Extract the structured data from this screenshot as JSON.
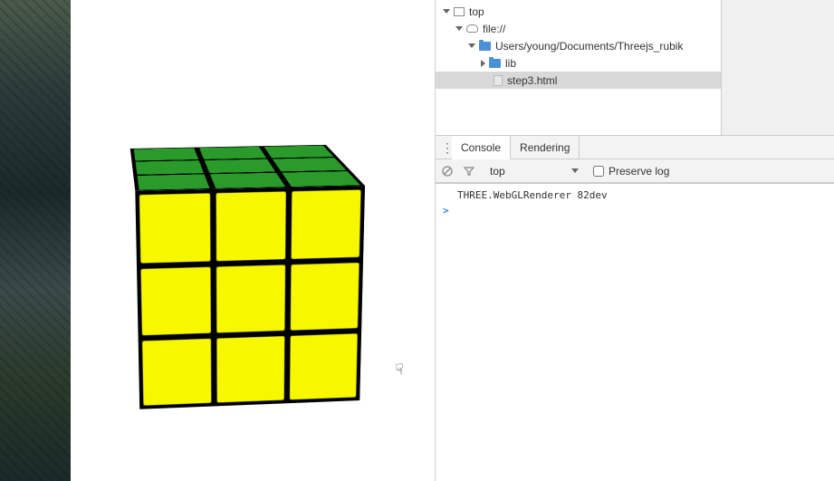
{
  "tree": {
    "root": "top",
    "scheme": "file://",
    "path": "Users/young/Documents/Threejs_rubik",
    "folder": "lib",
    "file": "step3.html"
  },
  "tabs": {
    "console": "Console",
    "rendering": "Rendering"
  },
  "toolbar": {
    "context": "top",
    "preserve_label": "Preserve log"
  },
  "console": {
    "log1": "THREE.WebGLRenderer 82dev",
    "prompt": ">"
  }
}
